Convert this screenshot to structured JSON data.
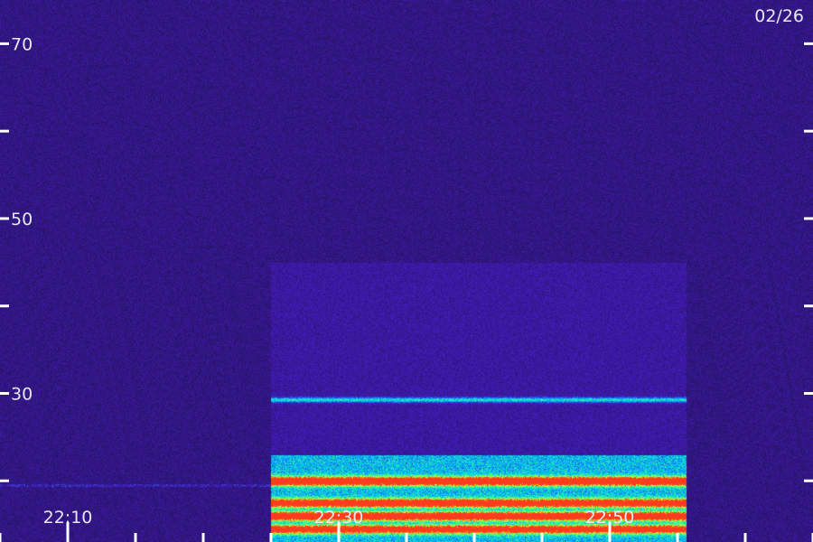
{
  "chart_data": {
    "type": "heatmap",
    "date_label": "02/26",
    "x_ticks": [
      {
        "label": "22:10",
        "minute": 10
      },
      {
        "label": "22:30",
        "minute": 30
      },
      {
        "label": "22:50",
        "minute": 50
      }
    ],
    "x_range_minutes": [
      5,
      65
    ],
    "x_minor_step_minutes": 5,
    "y_ticks": [
      {
        "label": "70",
        "value": 70
      },
      {
        "label": "50",
        "value": 50
      },
      {
        "label": "30",
        "value": 30
      }
    ],
    "y_range": [
      13,
      75
    ],
    "y_minor_step": 10,
    "signal": {
      "start_minute": 25,
      "end_minute": 55.6,
      "noise_band_top": 45,
      "bands": [
        {
          "value": 29.3,
          "strength": 0.5
        },
        {
          "value": 20.0,
          "strength": 0.95
        },
        {
          "value": 17.5,
          "strength": 0.85
        },
        {
          "value": 16.0,
          "strength": 0.9
        },
        {
          "value": 14.5,
          "strength": 0.8
        }
      ]
    },
    "colors": {
      "background": "#2a1466",
      "low": "#3c1eb4",
      "mid": "#00c8ff",
      "high": "#aaff22",
      "peak": "#ff3322"
    }
  }
}
